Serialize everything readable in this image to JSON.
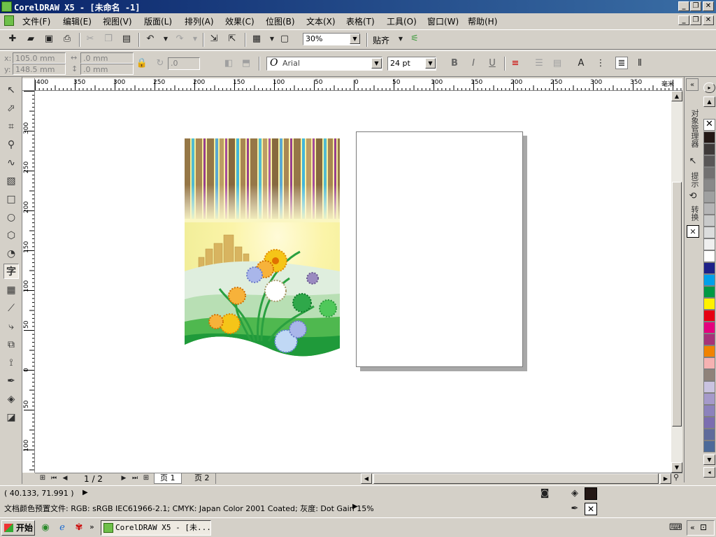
{
  "window": {
    "title": "CorelDRAW X5 - [未命名 -1]",
    "controls": [
      "_",
      "❐",
      "✕"
    ]
  },
  "menu": [
    "文件(F)",
    "编辑(E)",
    "视图(V)",
    "版面(L)",
    "排列(A)",
    "效果(C)",
    "位图(B)",
    "文本(X)",
    "表格(T)",
    "工具(O)",
    "窗口(W)",
    "帮助(H)"
  ],
  "standard_toolbar": {
    "zoom_value": "30%",
    "snap_label": "贴齐"
  },
  "property_bar": {
    "x_label": "x:",
    "x_value": "105.0 mm",
    "y_label": "y:",
    "y_value": "148.5 mm",
    "w_value": ".0 mm",
    "h_value": ".0 mm",
    "angle_value": ".0",
    "font_name": "Arial",
    "font_size": "24 pt",
    "bold_label": "B",
    "italic_label": "I",
    "underline_label": "U"
  },
  "rulers": {
    "horizontal_labels": [
      "400",
      "350",
      "300",
      "250",
      "200",
      "150",
      "100",
      "50",
      "0",
      "50",
      "100",
      "150",
      "200",
      "250",
      "300",
      "350"
    ],
    "vertical_labels": [
      "300",
      "250",
      "200",
      "150",
      "100",
      "50",
      "0",
      "50",
      "100"
    ],
    "unit": "毫米"
  },
  "page_nav": {
    "counter": "1 / 2",
    "tabs": [
      "页 1",
      "页 2"
    ]
  },
  "docker_tabs": [
    "对象管理器",
    "提示",
    "转换"
  ],
  "palette_colors": [
    "#231815",
    "#3e3a39",
    "#595757",
    "#727171",
    "#898989",
    "#9fa0a0",
    "#b5b5b6",
    "#c9caca",
    "#dcdddd",
    "#efefef",
    "#ffffff",
    "#1d2088",
    "#00a0e9",
    "#009944",
    "#fff100",
    "#e60012",
    "#e4007f",
    "#a6327a",
    "#f08300",
    "#f5b2b2",
    "#8f8279",
    "#c9c3e0",
    "#a59aca",
    "#8c82bc",
    "#7b6db0",
    "#5f6b9b",
    "#4c6a99"
  ],
  "status": {
    "coords": "( 40.133, 71.991 )",
    "color_profile": "文档颜色预置文件: RGB: sRGB IEC61966-2.1; CMYK: Japan Color 2001 Coated; 灰度: Dot Gain 15%",
    "fill_color": "#231815"
  },
  "taskbar": {
    "start_label": "开始",
    "app_label": "CorelDRAW X5 - [未..."
  }
}
